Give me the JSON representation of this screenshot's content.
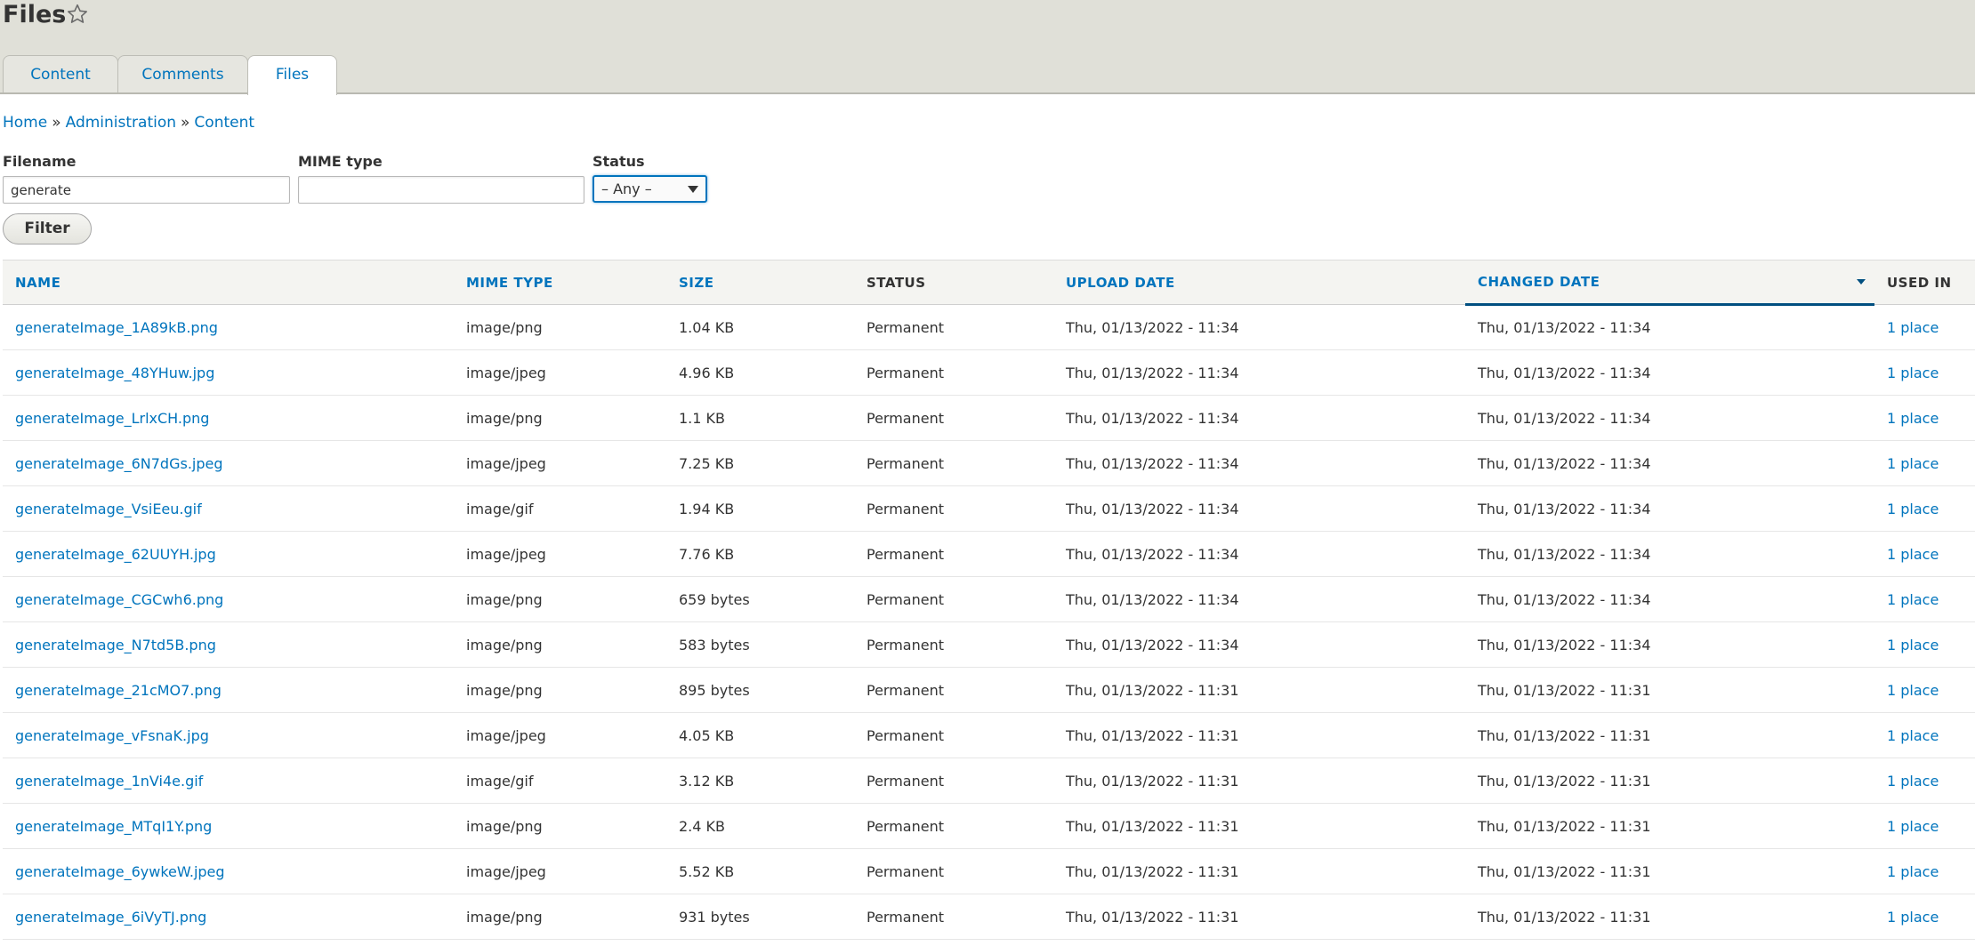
{
  "page": {
    "title": "Files"
  },
  "tabs": [
    {
      "label": "Content"
    },
    {
      "label": "Comments"
    },
    {
      "label": "Files"
    }
  ],
  "breadcrumb": {
    "items": [
      "Home",
      "Administration",
      "Content"
    ],
    "separator": "»"
  },
  "filters": {
    "filename": {
      "label": "Filename",
      "value": "generate"
    },
    "mime": {
      "label": "MIME type",
      "value": ""
    },
    "status": {
      "label": "Status",
      "selected": "– Any –"
    },
    "button": "Filter"
  },
  "table": {
    "columns": [
      "NAME",
      "MIME TYPE",
      "SIZE",
      "STATUS",
      "UPLOAD DATE",
      "CHANGED DATE",
      "USED IN"
    ],
    "rows": [
      {
        "name": "generateImage_1A89kB.png",
        "mime": "image/png",
        "size": "1.04 KB",
        "status": "Permanent",
        "upload": "Thu, 01/13/2022 - 11:34",
        "changed": "Thu, 01/13/2022 - 11:34",
        "used": "1 place"
      },
      {
        "name": "generateImage_48YHuw.jpg",
        "mime": "image/jpeg",
        "size": "4.96 KB",
        "status": "Permanent",
        "upload": "Thu, 01/13/2022 - 11:34",
        "changed": "Thu, 01/13/2022 - 11:34",
        "used": "1 place"
      },
      {
        "name": "generateImage_LrlxCH.png",
        "mime": "image/png",
        "size": "1.1 KB",
        "status": "Permanent",
        "upload": "Thu, 01/13/2022 - 11:34",
        "changed": "Thu, 01/13/2022 - 11:34",
        "used": "1 place"
      },
      {
        "name": "generateImage_6N7dGs.jpeg",
        "mime": "image/jpeg",
        "size": "7.25 KB",
        "status": "Permanent",
        "upload": "Thu, 01/13/2022 - 11:34",
        "changed": "Thu, 01/13/2022 - 11:34",
        "used": "1 place"
      },
      {
        "name": "generateImage_VsiEeu.gif",
        "mime": "image/gif",
        "size": "1.94 KB",
        "status": "Permanent",
        "upload": "Thu, 01/13/2022 - 11:34",
        "changed": "Thu, 01/13/2022 - 11:34",
        "used": "1 place"
      },
      {
        "name": "generateImage_62UUYH.jpg",
        "mime": "image/jpeg",
        "size": "7.76 KB",
        "status": "Permanent",
        "upload": "Thu, 01/13/2022 - 11:34",
        "changed": "Thu, 01/13/2022 - 11:34",
        "used": "1 place"
      },
      {
        "name": "generateImage_CGCwh6.png",
        "mime": "image/png",
        "size": "659 bytes",
        "status": "Permanent",
        "upload": "Thu, 01/13/2022 - 11:34",
        "changed": "Thu, 01/13/2022 - 11:34",
        "used": "1 place"
      },
      {
        "name": "generateImage_N7td5B.png",
        "mime": "image/png",
        "size": "583 bytes",
        "status": "Permanent",
        "upload": "Thu, 01/13/2022 - 11:34",
        "changed": "Thu, 01/13/2022 - 11:34",
        "used": "1 place"
      },
      {
        "name": "generateImage_21cMO7.png",
        "mime": "image/png",
        "size": "895 bytes",
        "status": "Permanent",
        "upload": "Thu, 01/13/2022 - 11:31",
        "changed": "Thu, 01/13/2022 - 11:31",
        "used": "1 place"
      },
      {
        "name": "generateImage_vFsnaK.jpg",
        "mime": "image/jpeg",
        "size": "4.05 KB",
        "status": "Permanent",
        "upload": "Thu, 01/13/2022 - 11:31",
        "changed": "Thu, 01/13/2022 - 11:31",
        "used": "1 place"
      },
      {
        "name": "generateImage_1nVi4e.gif",
        "mime": "image/gif",
        "size": "3.12 KB",
        "status": "Permanent",
        "upload": "Thu, 01/13/2022 - 11:31",
        "changed": "Thu, 01/13/2022 - 11:31",
        "used": "1 place"
      },
      {
        "name": "generateImage_MTqI1Y.png",
        "mime": "image/png",
        "size": "2.4 KB",
        "status": "Permanent",
        "upload": "Thu, 01/13/2022 - 11:31",
        "changed": "Thu, 01/13/2022 - 11:31",
        "used": "1 place"
      },
      {
        "name": "generateImage_6ywkeW.jpeg",
        "mime": "image/jpeg",
        "size": "5.52 KB",
        "status": "Permanent",
        "upload": "Thu, 01/13/2022 - 11:31",
        "changed": "Thu, 01/13/2022 - 11:31",
        "used": "1 place"
      },
      {
        "name": "generateImage_6iVyTJ.png",
        "mime": "image/png",
        "size": "931 bytes",
        "status": "Permanent",
        "upload": "Thu, 01/13/2022 - 11:31",
        "changed": "Thu, 01/13/2022 - 11:31",
        "used": "1 place"
      }
    ]
  },
  "colors": {
    "link": "#0074bd",
    "header_bg": "#e0e0d8",
    "text": "#333333"
  },
  "icons": {
    "favorite": "star-outline-icon",
    "sort": "sort-descending-icon",
    "select": "chevron-down-icon"
  }
}
